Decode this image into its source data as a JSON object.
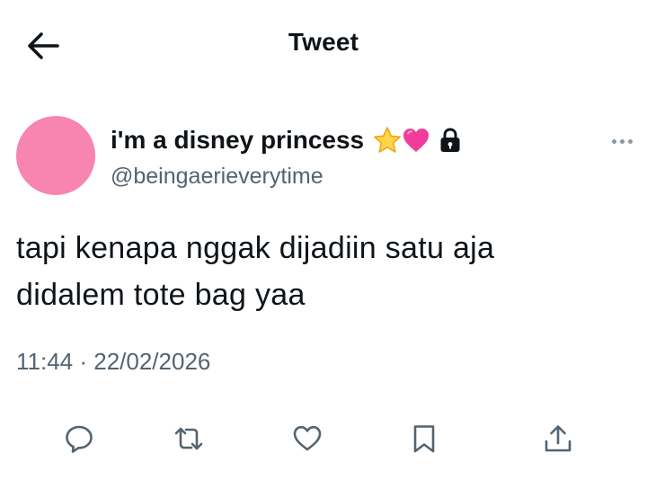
{
  "header": {
    "title": "Tweet",
    "back_icon": "arrow-left-icon"
  },
  "tweet": {
    "author": {
      "display_name": "i'm a disney princess",
      "emojis": [
        "star-emoji",
        "pink-heart-emoji"
      ],
      "protected_icon": "lock-icon",
      "handle": "@beingaerieverytime",
      "avatar_color": "#f884b0"
    },
    "text_lines": [
      "tapi kenapa nggak dijadiin satu aja",
      "didalem tote bag yaa"
    ],
    "timestamp": "11:44 · 22/02/2026",
    "more_icon": "more-horizontal-icon"
  },
  "actions": [
    {
      "icon": "reply-icon"
    },
    {
      "icon": "retweet-icon"
    },
    {
      "icon": "like-icon"
    },
    {
      "icon": "bookmark-icon"
    },
    {
      "icon": "share-icon"
    }
  ],
  "colors": {
    "text_primary": "#0f1419",
    "text_secondary": "#536471",
    "icon_gray": "#536471"
  }
}
